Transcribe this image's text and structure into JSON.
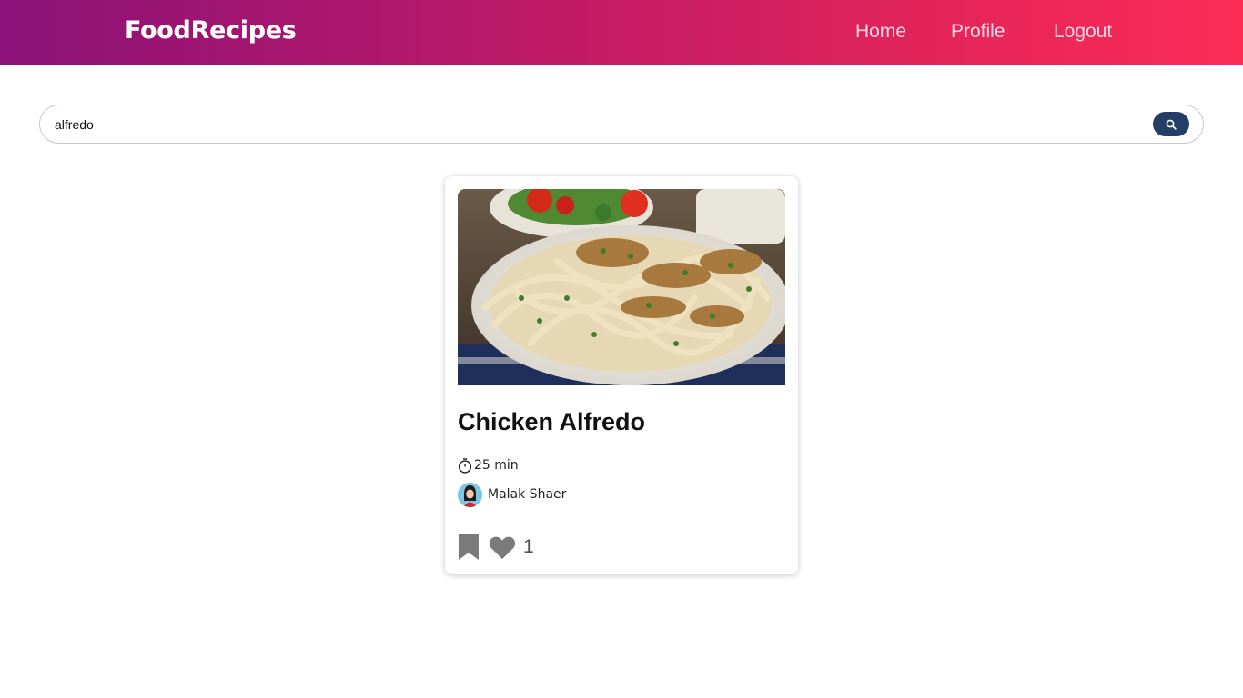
{
  "header": {
    "brand": "FoodRecipes",
    "nav": {
      "home": "Home",
      "profile": "Profile",
      "logout": "Logout"
    },
    "gradient_colors": [
      "#8a1278",
      "#fc2c55"
    ]
  },
  "search": {
    "value": "alfredo",
    "button_color": "#243f66",
    "button_icon": "search-icon"
  },
  "recipe_card": {
    "title": "Chicken Alfredo",
    "time": "25 min",
    "time_icon": "stopwatch-icon",
    "author": "Malak Shaer",
    "likes": "1",
    "bookmark_icon": "bookmark-icon",
    "like_icon": "heart-icon"
  }
}
